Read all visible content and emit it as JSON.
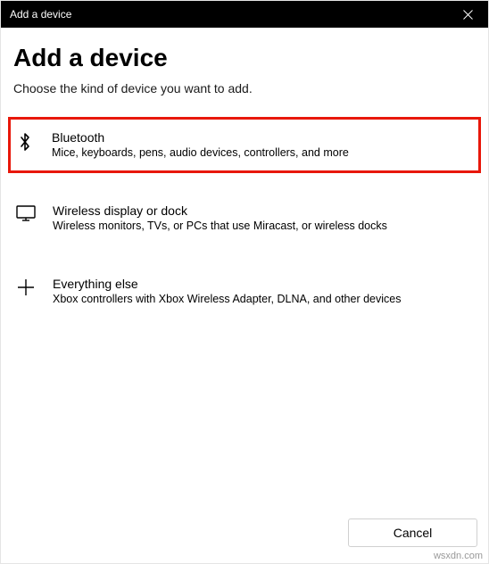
{
  "titlebar": {
    "title": "Add a device"
  },
  "header": {
    "heading": "Add a device",
    "subtitle": "Choose the kind of device you want to add."
  },
  "options": [
    {
      "title": "Bluetooth",
      "desc": "Mice, keyboards, pens, audio devices, controllers, and more"
    },
    {
      "title": "Wireless display or dock",
      "desc": "Wireless monitors, TVs, or PCs that use Miracast, or wireless docks"
    },
    {
      "title": "Everything else",
      "desc": "Xbox controllers with Xbox Wireless Adapter, DLNA, and other devices"
    }
  ],
  "footer": {
    "cancel_label": "Cancel"
  },
  "watermark": "wsxdn.com"
}
